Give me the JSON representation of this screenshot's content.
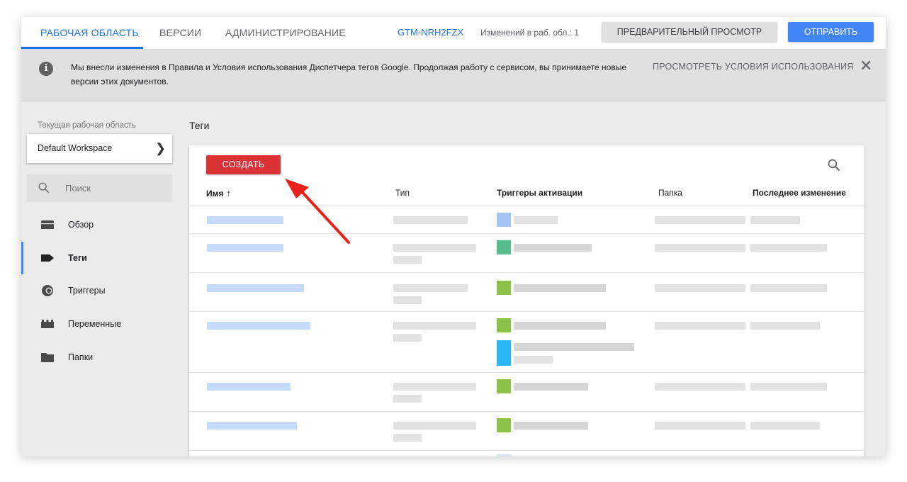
{
  "topbar": {
    "tabs": [
      {
        "label": "РАБОЧАЯ ОБЛАСТЬ"
      },
      {
        "label": "ВЕРСИИ"
      },
      {
        "label": "АДМИНИСТРИРОВАНИЕ"
      }
    ],
    "container_id": "GTM-NRH2FZX",
    "changes_text": "Изменений в раб. обл.: 1",
    "preview_label": "ПРЕДВАРИТЕЛЬНЫЙ ПРОСМОТР",
    "submit_label": "ОТПРАВИТЬ"
  },
  "notice": {
    "icon": "info-icon",
    "text": "Мы внесли изменения в Правила и Условия использования Диспетчера тегов Google. Продолжая работу с сервисом, вы принимаете новые версии этих документов.",
    "link_label": "ПРОСМОТРЕТЬ УСЛОВИЯ ИСПОЛЬЗОВАНИЯ",
    "close_icon": "close-icon"
  },
  "sidebar": {
    "workspace_label": "Текущая рабочая область",
    "workspace_name": "Default Workspace",
    "search_placeholder": "Поиск",
    "items": [
      {
        "label": "Обзор",
        "icon": "overview-folder-icon"
      },
      {
        "label": "Теги",
        "icon": "tag-icon"
      },
      {
        "label": "Триггеры",
        "icon": "trigger-icon"
      },
      {
        "label": "Переменные",
        "icon": "variables-icon"
      },
      {
        "label": "Папки",
        "icon": "folder-icon"
      }
    ]
  },
  "main": {
    "section_title": "Теги",
    "create_label": "СОЗДАТЬ",
    "columns": {
      "name": "Имя",
      "sort_arrow": "↑",
      "type": "Тип",
      "triggers": "Триггеры активации",
      "folder": "Папка",
      "modified": "Последнее изменение"
    }
  },
  "colors": {
    "accent": "#1a73e8",
    "submit": "#4285f4",
    "create": "#db3236",
    "annotation_arrow": "#e8211c"
  }
}
